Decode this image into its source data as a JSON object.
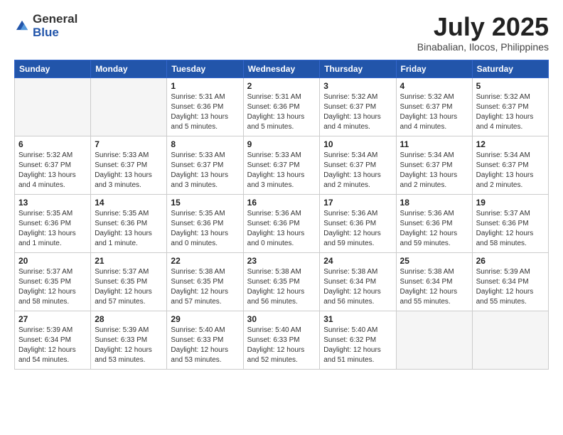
{
  "logo": {
    "general": "General",
    "blue": "Blue"
  },
  "title": "July 2025",
  "location": "Binabalian, Ilocos, Philippines",
  "weekdays": [
    "Sunday",
    "Monday",
    "Tuesday",
    "Wednesday",
    "Thursday",
    "Friday",
    "Saturday"
  ],
  "weeks": [
    [
      {
        "day": "",
        "info": ""
      },
      {
        "day": "",
        "info": ""
      },
      {
        "day": "1",
        "info": "Sunrise: 5:31 AM\nSunset: 6:36 PM\nDaylight: 13 hours and 5 minutes."
      },
      {
        "day": "2",
        "info": "Sunrise: 5:31 AM\nSunset: 6:36 PM\nDaylight: 13 hours and 5 minutes."
      },
      {
        "day": "3",
        "info": "Sunrise: 5:32 AM\nSunset: 6:37 PM\nDaylight: 13 hours and 4 minutes."
      },
      {
        "day": "4",
        "info": "Sunrise: 5:32 AM\nSunset: 6:37 PM\nDaylight: 13 hours and 4 minutes."
      },
      {
        "day": "5",
        "info": "Sunrise: 5:32 AM\nSunset: 6:37 PM\nDaylight: 13 hours and 4 minutes."
      }
    ],
    [
      {
        "day": "6",
        "info": "Sunrise: 5:32 AM\nSunset: 6:37 PM\nDaylight: 13 hours and 4 minutes."
      },
      {
        "day": "7",
        "info": "Sunrise: 5:33 AM\nSunset: 6:37 PM\nDaylight: 13 hours and 3 minutes."
      },
      {
        "day": "8",
        "info": "Sunrise: 5:33 AM\nSunset: 6:37 PM\nDaylight: 13 hours and 3 minutes."
      },
      {
        "day": "9",
        "info": "Sunrise: 5:33 AM\nSunset: 6:37 PM\nDaylight: 13 hours and 3 minutes."
      },
      {
        "day": "10",
        "info": "Sunrise: 5:34 AM\nSunset: 6:37 PM\nDaylight: 13 hours and 2 minutes."
      },
      {
        "day": "11",
        "info": "Sunrise: 5:34 AM\nSunset: 6:37 PM\nDaylight: 13 hours and 2 minutes."
      },
      {
        "day": "12",
        "info": "Sunrise: 5:34 AM\nSunset: 6:37 PM\nDaylight: 13 hours and 2 minutes."
      }
    ],
    [
      {
        "day": "13",
        "info": "Sunrise: 5:35 AM\nSunset: 6:36 PM\nDaylight: 13 hours and 1 minute."
      },
      {
        "day": "14",
        "info": "Sunrise: 5:35 AM\nSunset: 6:36 PM\nDaylight: 13 hours and 1 minute."
      },
      {
        "day": "15",
        "info": "Sunrise: 5:35 AM\nSunset: 6:36 PM\nDaylight: 13 hours and 0 minutes."
      },
      {
        "day": "16",
        "info": "Sunrise: 5:36 AM\nSunset: 6:36 PM\nDaylight: 13 hours and 0 minutes."
      },
      {
        "day": "17",
        "info": "Sunrise: 5:36 AM\nSunset: 6:36 PM\nDaylight: 12 hours and 59 minutes."
      },
      {
        "day": "18",
        "info": "Sunrise: 5:36 AM\nSunset: 6:36 PM\nDaylight: 12 hours and 59 minutes."
      },
      {
        "day": "19",
        "info": "Sunrise: 5:37 AM\nSunset: 6:36 PM\nDaylight: 12 hours and 58 minutes."
      }
    ],
    [
      {
        "day": "20",
        "info": "Sunrise: 5:37 AM\nSunset: 6:35 PM\nDaylight: 12 hours and 58 minutes."
      },
      {
        "day": "21",
        "info": "Sunrise: 5:37 AM\nSunset: 6:35 PM\nDaylight: 12 hours and 57 minutes."
      },
      {
        "day": "22",
        "info": "Sunrise: 5:38 AM\nSunset: 6:35 PM\nDaylight: 12 hours and 57 minutes."
      },
      {
        "day": "23",
        "info": "Sunrise: 5:38 AM\nSunset: 6:35 PM\nDaylight: 12 hours and 56 minutes."
      },
      {
        "day": "24",
        "info": "Sunrise: 5:38 AM\nSunset: 6:34 PM\nDaylight: 12 hours and 56 minutes."
      },
      {
        "day": "25",
        "info": "Sunrise: 5:38 AM\nSunset: 6:34 PM\nDaylight: 12 hours and 55 minutes."
      },
      {
        "day": "26",
        "info": "Sunrise: 5:39 AM\nSunset: 6:34 PM\nDaylight: 12 hours and 55 minutes."
      }
    ],
    [
      {
        "day": "27",
        "info": "Sunrise: 5:39 AM\nSunset: 6:34 PM\nDaylight: 12 hours and 54 minutes."
      },
      {
        "day": "28",
        "info": "Sunrise: 5:39 AM\nSunset: 6:33 PM\nDaylight: 12 hours and 53 minutes."
      },
      {
        "day": "29",
        "info": "Sunrise: 5:40 AM\nSunset: 6:33 PM\nDaylight: 12 hours and 53 minutes."
      },
      {
        "day": "30",
        "info": "Sunrise: 5:40 AM\nSunset: 6:33 PM\nDaylight: 12 hours and 52 minutes."
      },
      {
        "day": "31",
        "info": "Sunrise: 5:40 AM\nSunset: 6:32 PM\nDaylight: 12 hours and 51 minutes."
      },
      {
        "day": "",
        "info": ""
      },
      {
        "day": "",
        "info": ""
      }
    ]
  ]
}
